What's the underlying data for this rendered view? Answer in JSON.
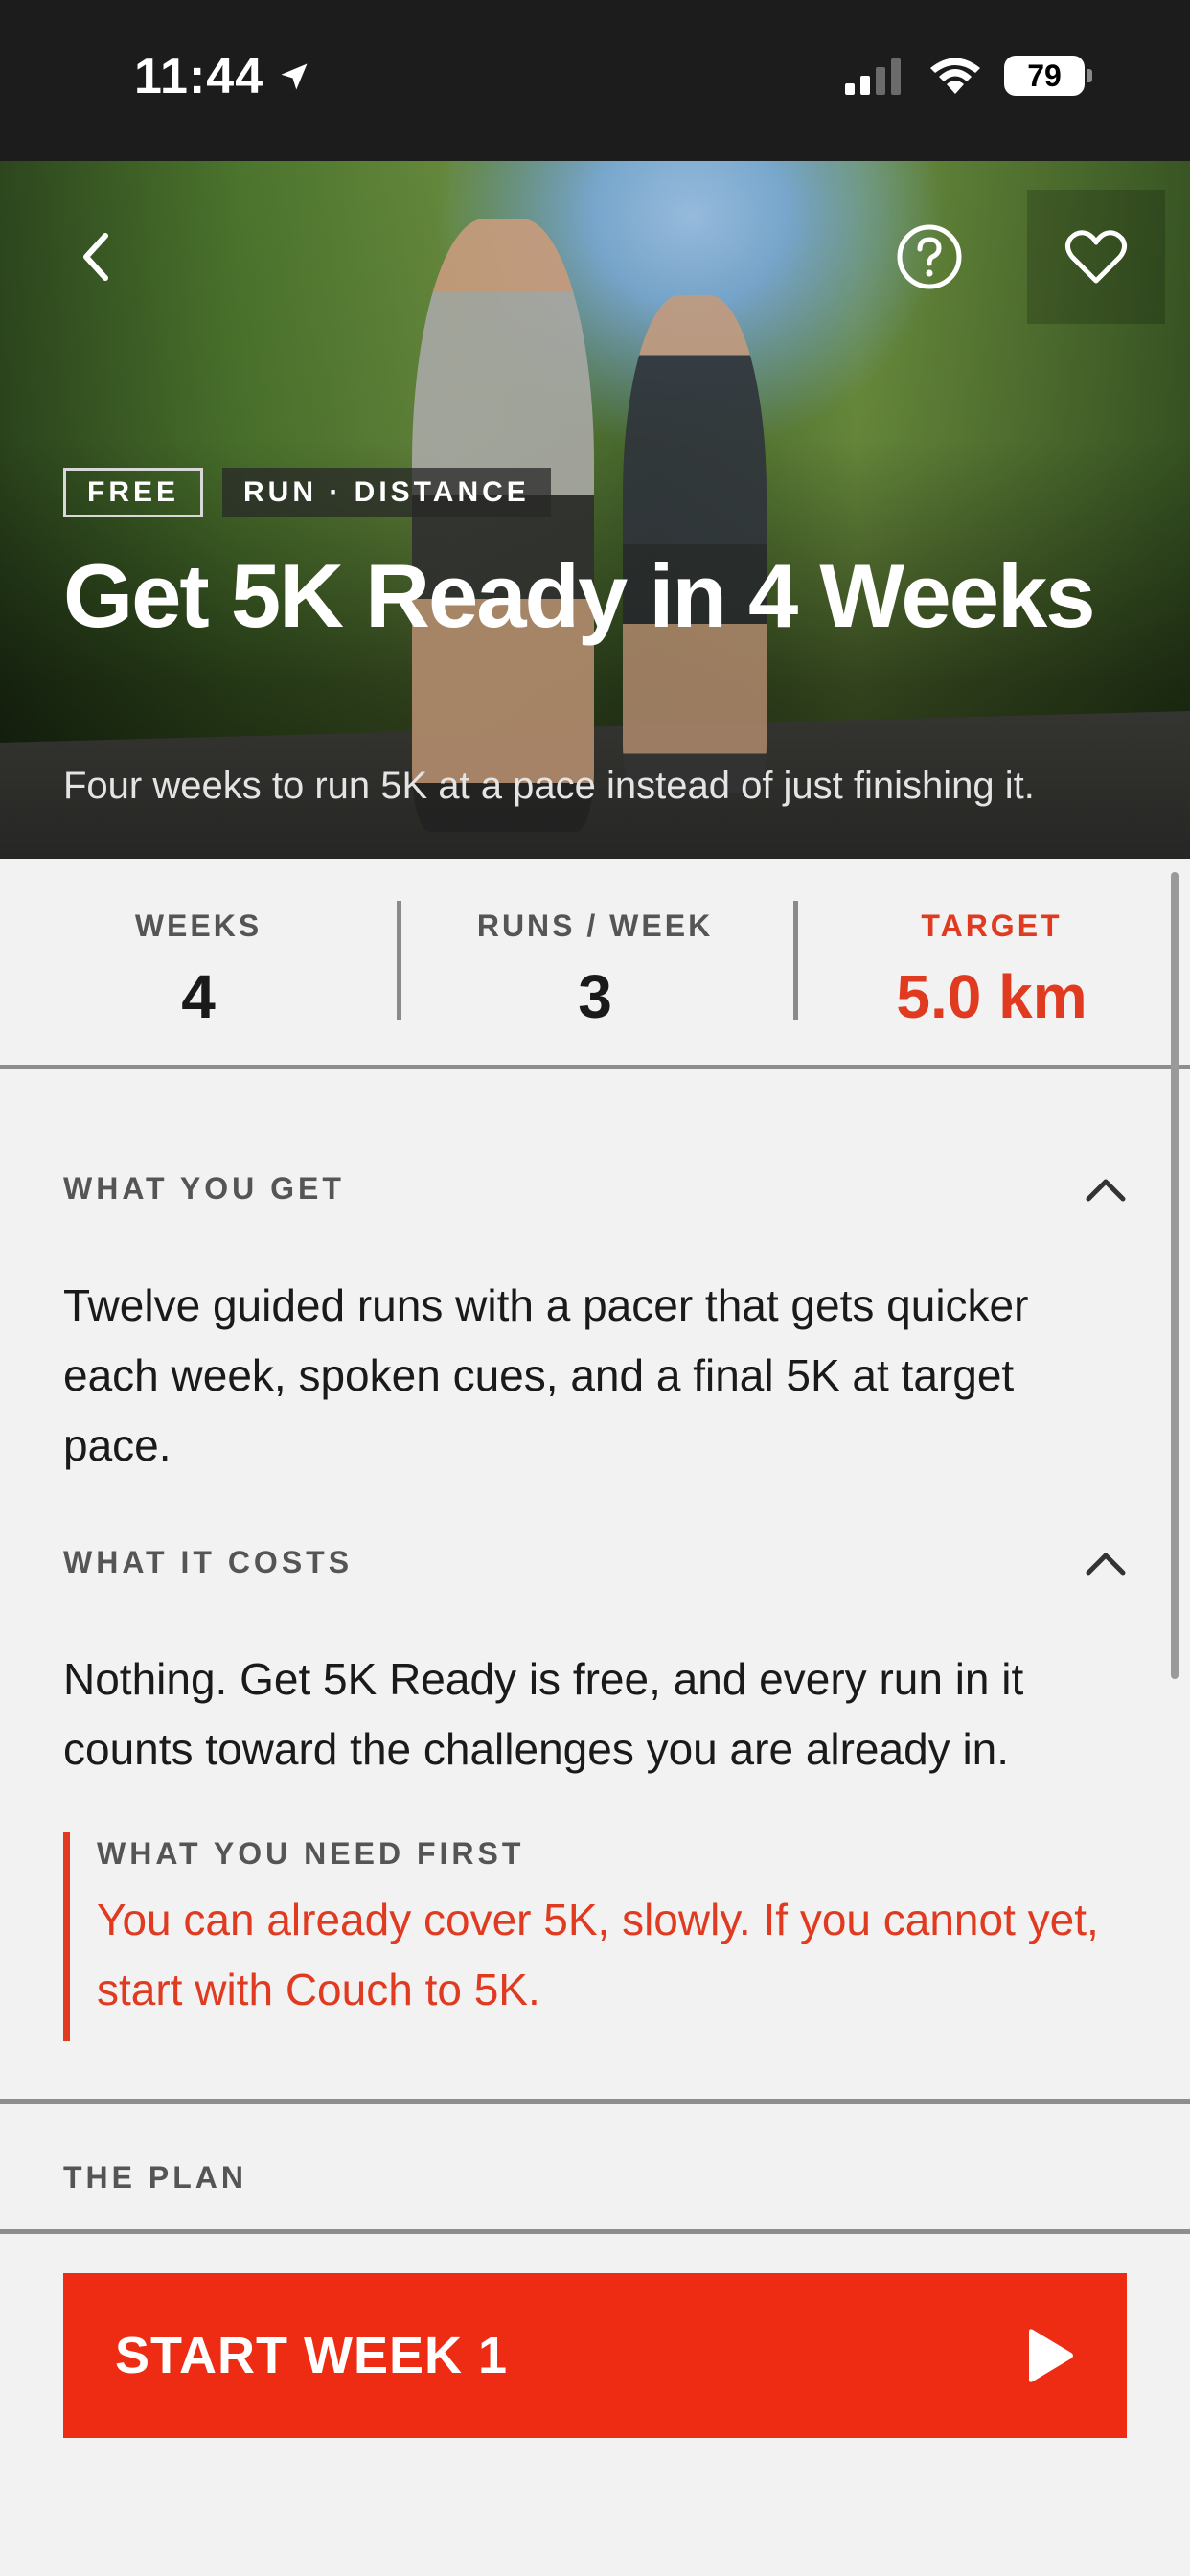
{
  "status_bar": {
    "time": "11:44",
    "battery": "79"
  },
  "hero": {
    "tags": [
      "FREE",
      "RUN · DISTANCE"
    ],
    "title": "Get 5K Ready in 4 Weeks",
    "subtitle": "Four weeks to run 5K at a pace instead of just finishing it."
  },
  "stats": [
    {
      "label": "WEEKS",
      "value": "4"
    },
    {
      "label": "RUNS / WEEK",
      "value": "3"
    },
    {
      "label": "TARGET",
      "value": "5.0 km"
    }
  ],
  "sections": {
    "what_you_get": {
      "label": "WHAT YOU GET",
      "body": "Twelve guided runs with a pacer that gets quicker each week, spoken cues, and a final 5K at target pace."
    },
    "what_it_costs": {
      "label": "WHAT IT COSTS",
      "body": "Nothing. Get 5K Ready is free, and every run in it counts toward the challenges you are already in."
    },
    "what_you_need": {
      "label": "WHAT YOU NEED FIRST",
      "body": "You can already cover 5K, slowly. If you cannot yet, start with Couch to 5K."
    },
    "plan": {
      "label": "THE PLAN"
    }
  },
  "cta": {
    "label": "START WEEK 1"
  },
  "colors": {
    "accent": "#ee2c14",
    "accent_text": "#e03a20",
    "background": "#f2f2f2"
  },
  "icons": [
    "location-arrow-icon",
    "signal-icon",
    "wifi-icon",
    "back-arrow-icon",
    "help-icon",
    "heart-icon",
    "chevron-up-icon",
    "play-icon"
  ]
}
